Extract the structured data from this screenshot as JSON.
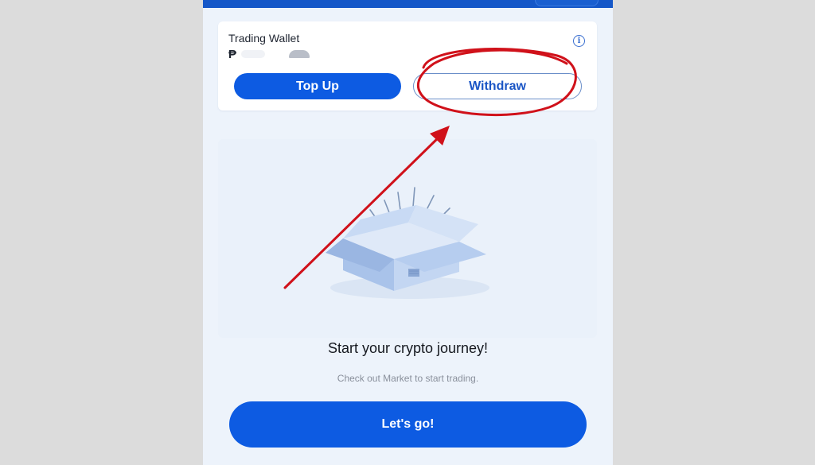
{
  "wallet": {
    "title": "Trading Wallet",
    "currency_symbol": "₱",
    "info_icon": "info-icon",
    "top_up_label": "Top Up",
    "withdraw_label": "Withdraw"
  },
  "empty_state": {
    "illustration": "open-box-illustration",
    "title": "Start your crypto journey!",
    "subtitle": "Check out Market to start trading.",
    "cta_label": "Let's go!"
  },
  "annotation": {
    "type": "red-circle-and-arrow",
    "target": "withdraw-button",
    "color": "#d0111a"
  },
  "colors": {
    "primary": "#0d5be2",
    "header": "#1557c8",
    "background": "#edf3fb",
    "annotation": "#d0111a"
  }
}
